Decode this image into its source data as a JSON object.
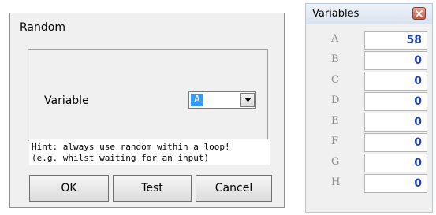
{
  "random_dialog": {
    "title": "Random",
    "variable_label": "Variable",
    "selected_variable": "A",
    "hint_lines": [
      "Hint: always use random within a loop!",
      "(e.g. whilst waiting for an input)"
    ],
    "buttons": {
      "ok": "OK",
      "test": "Test",
      "cancel": "Cancel"
    }
  },
  "variables_panel": {
    "title": "Variables",
    "rows": [
      {
        "name": "A",
        "value": "58"
      },
      {
        "name": "B",
        "value": "0"
      },
      {
        "name": "C",
        "value": "0"
      },
      {
        "name": "D",
        "value": "0"
      },
      {
        "name": "E",
        "value": "0"
      },
      {
        "name": "F",
        "value": "0"
      },
      {
        "name": "G",
        "value": "0"
      },
      {
        "name": "H",
        "value": "0"
      }
    ]
  },
  "icons": {
    "dropdown": "chevron-down-icon",
    "close": "close-icon"
  },
  "colors": {
    "selection": "#3399ff",
    "value_text": "#1a3fbf",
    "close_button": "#c45a43"
  }
}
